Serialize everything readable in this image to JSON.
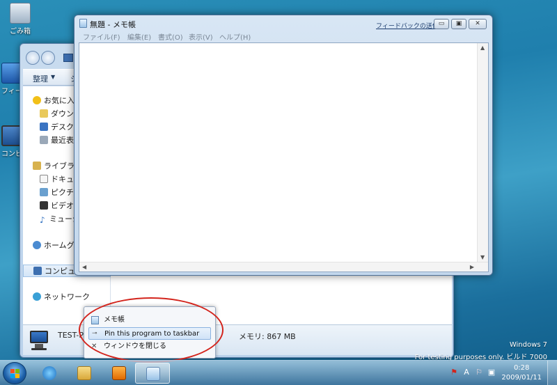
{
  "desktop": {
    "icons": [
      {
        "label": "ごみ箱"
      },
      {
        "label": "フィードバック"
      },
      {
        "label": "コンピュ"
      }
    ]
  },
  "explorer": {
    "commands": [
      "整理",
      "シ"
    ],
    "navpane": {
      "favorites": "お気に入り",
      "downloads": "ダウンロ",
      "desktop": "デスクト",
      "recent": "最近表示",
      "libraries": "ライブラリ",
      "documents": "ドキュメ",
      "pictures": "ピクチャ",
      "videos": "ビデオ",
      "music": "ミュージ",
      "homegroup": "ホームグル",
      "computer": "コンピュー",
      "network": "ネットワーク"
    },
    "details": {
      "name": "TEST-P",
      "memory": "メモリ: 867 MB"
    }
  },
  "notepad": {
    "title": "無題 - メモ帳",
    "feedback": "フィードバックの送信",
    "menu": [
      "ファイル(F)",
      "編集(E)",
      "書式(O)",
      "表示(V)",
      "ヘルプ(H)"
    ],
    "text": ""
  },
  "jumplist": {
    "items": [
      {
        "label": "メモ帳"
      },
      {
        "label": "Pin this program to taskbar"
      },
      {
        "label": "ウィンドウを閉じる"
      }
    ]
  },
  "watermark": {
    "line1": "Windows 7",
    "line2": "For testing purposes only. ビルド 7000"
  },
  "taskbar": {
    "tray_ime": "A",
    "clock_time": "0:28",
    "clock_date": "2009/01/11"
  },
  "colors": {
    "accent": "#d3241c",
    "window_frame": "#c3d7ec",
    "taskbar": "#4678a0"
  }
}
